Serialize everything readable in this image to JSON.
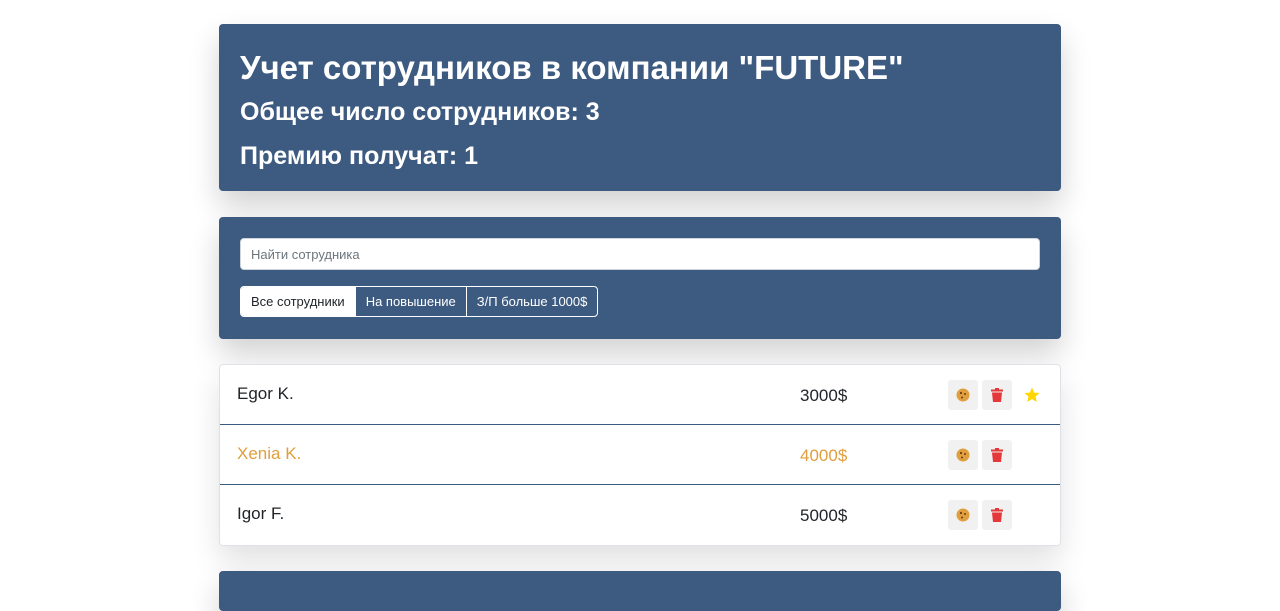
{
  "header": {
    "title": "Учет сотрудников в компании \"FUTURE\"",
    "total": "Общее число сотрудников: 3",
    "bonus": "Премию получат: 1"
  },
  "search": {
    "placeholder": "Найти сотрудника",
    "value": ""
  },
  "filters": [
    {
      "label": "Все сотрудники",
      "active": true
    },
    {
      "label": "На повышение",
      "active": false
    },
    {
      "label": "З/П больше 1000$",
      "active": false
    }
  ],
  "employees": [
    {
      "name": "Egor K.",
      "salary": "3000$",
      "increase": false,
      "rise": true
    },
    {
      "name": "Xenia K.",
      "salary": "4000$",
      "increase": true,
      "rise": false
    },
    {
      "name": "Igor F.",
      "salary": "5000$",
      "increase": false,
      "rise": false
    }
  ],
  "colors": {
    "panel": "#3d5a80",
    "cookie": "#e09f3e",
    "trash": "#e5383b",
    "star": "#ffd700"
  },
  "icons": {
    "increase_button": "cookie-icon",
    "delete_button": "trash-icon",
    "rise_marker": "star-icon"
  }
}
